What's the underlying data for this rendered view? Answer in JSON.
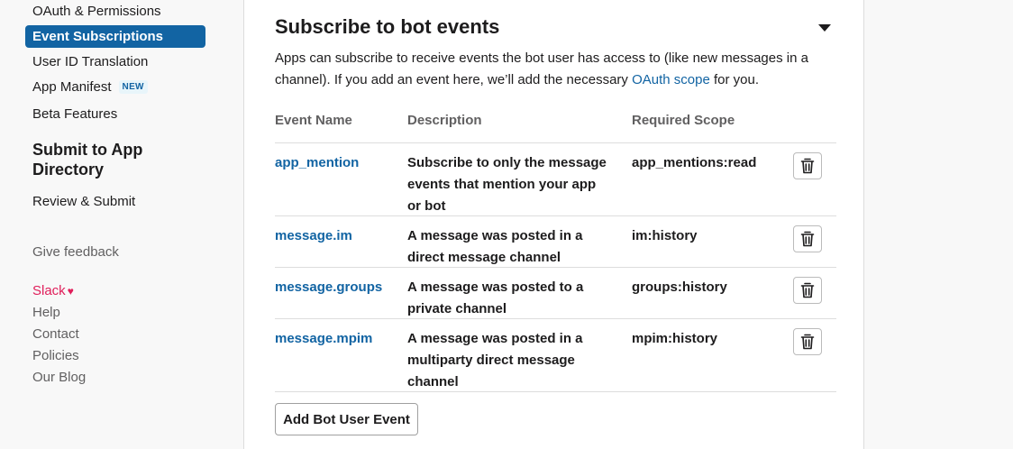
{
  "sidebar": {
    "items": [
      {
        "label": "OAuth & Permissions"
      },
      {
        "label": "Event Subscriptions"
      },
      {
        "label": "User ID Translation"
      },
      {
        "label": "App Manifest",
        "badge": "NEW"
      },
      {
        "label": "Beta Features"
      }
    ],
    "directory_heading": "Submit to App Directory",
    "review_submit": "Review & Submit",
    "give_feedback": "Give feedback",
    "footer_links": {
      "slack": "Slack",
      "help": "Help",
      "contact": "Contact",
      "policies": "Policies",
      "blog": "Our Blog"
    },
    "active_color": "#1264a3"
  },
  "main": {
    "title": "Subscribe to bot events",
    "description_part1": "Apps can subscribe to receive events the bot user has access to (like new messages in a channel). If you add an event here, we’ll add the necessary ",
    "description_link": "OAuth scope",
    "description_part2": " for you.",
    "table": {
      "headers": {
        "name": "Event Name",
        "description": "Description",
        "scope": "Required Scope"
      },
      "rows": [
        {
          "name": "app_mention",
          "description": "Subscribe to only the message events that mention your app or bot",
          "scope": "app_mentions:read"
        },
        {
          "name": "message.im",
          "description": "A message was posted in a direct message channel",
          "scope": "im:history"
        },
        {
          "name": "message.groups",
          "description": "A message was posted to a private channel",
          "scope": "groups:history"
        },
        {
          "name": "message.mpim",
          "description": "A message was posted in a multiparty direct message channel",
          "scope": "mpim:history"
        }
      ]
    },
    "add_button": "Add Bot User Event",
    "link_color": "#1264a3"
  }
}
